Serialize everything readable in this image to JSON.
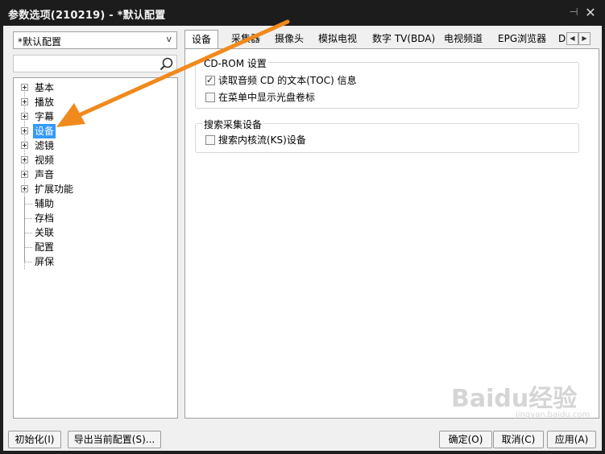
{
  "window": {
    "title": "参数选项(210219) - *默认配置",
    "pin_glyph": "⊣",
    "close_glyph": "✕"
  },
  "profile_combo": {
    "value": "*默认配置",
    "arrow": "v"
  },
  "search": {
    "value": "",
    "placeholder": ""
  },
  "tree": {
    "items": [
      {
        "label": "基本",
        "expandable": true
      },
      {
        "label": "播放",
        "expandable": true
      },
      {
        "label": "字幕",
        "expandable": true
      },
      {
        "label": "设备",
        "expandable": true,
        "selected": true
      },
      {
        "label": "滤镜",
        "expandable": true
      },
      {
        "label": "视频",
        "expandable": true
      },
      {
        "label": "声音",
        "expandable": true
      },
      {
        "label": "扩展功能",
        "expandable": true
      },
      {
        "label": "辅助",
        "expandable": false
      },
      {
        "label": "存档",
        "expandable": false
      },
      {
        "label": "关联",
        "expandable": false
      },
      {
        "label": "配置",
        "expandable": false
      },
      {
        "label": "屏保",
        "expandable": false
      }
    ]
  },
  "tabs": {
    "items": [
      "设备",
      "采集器",
      "摄像头",
      "模拟电视",
      "数字 TV(BDA)",
      "电视频道",
      "EPG浏览器",
      "D"
    ],
    "active": "设备",
    "scroll_left": "◀",
    "scroll_right": "▶"
  },
  "cdrom_group": {
    "title": "CD-ROM 设置",
    "options": [
      {
        "label": "读取音频 CD 的文本(TOC) 信息",
        "checked": true
      },
      {
        "label": "在菜单中显示光盘卷标",
        "checked": false
      }
    ]
  },
  "search_group": {
    "title": "搜索采集设备",
    "options": [
      {
        "label": "搜索内核流(KS)设备",
        "checked": false
      }
    ]
  },
  "buttons": {
    "init": "初始化(I)",
    "export": "导出当前配置(S)...",
    "ok": "确定(O)",
    "cancel": "取消(C)",
    "apply": "应用(A)"
  },
  "annotation": {
    "color": "#f08a1c"
  },
  "watermark": {
    "text": "Baidu经验",
    "sub": "jingyan.baidu.com"
  }
}
